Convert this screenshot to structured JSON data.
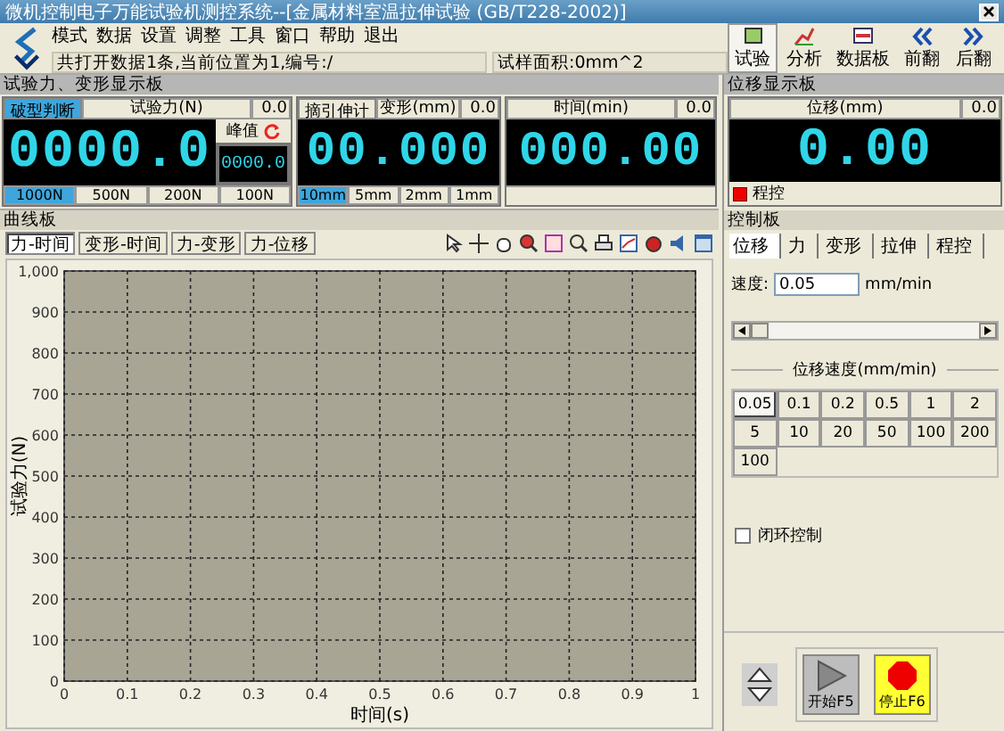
{
  "window": {
    "title": "微机控制电子万能试验机测控系统--[金属材料室温拉伸试验 (GB/T228-2002)]"
  },
  "menu": [
    "模式",
    "数据",
    "设置",
    "调整",
    "工具",
    "窗口",
    "帮助",
    "退出"
  ],
  "status": {
    "message": "共打开数据1条,当前位置为1,编号:/",
    "area": "试样面积:0mm^2"
  },
  "toolbar": [
    {
      "kind": "test",
      "label": "试验",
      "selected": true
    },
    {
      "kind": "analysis",
      "label": "分析",
      "selected": false
    },
    {
      "kind": "data",
      "label": "数据板",
      "selected": false
    },
    {
      "kind": "prev",
      "label": "前翻",
      "selected": false
    },
    {
      "kind": "next",
      "label": "后翻",
      "selected": false
    }
  ],
  "force_panel": {
    "title": "试验力、变形显示板",
    "force": {
      "button": "破型判断",
      "label": "试验力(N)",
      "zero": "0.0",
      "value": "0000.0",
      "peak_label": "峰值",
      "peak_value": "0000.0",
      "ranges": [
        {
          "label": "1000N",
          "selected": true
        },
        {
          "label": "500N",
          "selected": false
        },
        {
          "label": "200N",
          "selected": false
        },
        {
          "label": "100N",
          "selected": false
        }
      ]
    },
    "deform": {
      "button": "摘引伸计",
      "label": "变形(mm)",
      "zero": "0.0",
      "value": "00.000",
      "ranges": [
        {
          "label": "10mm",
          "selected": true
        },
        {
          "label": "5mm",
          "selected": false
        },
        {
          "label": "2mm",
          "selected": false
        },
        {
          "label": "1mm",
          "selected": false
        }
      ]
    },
    "time": {
      "label": "时间(min)",
      "zero": "0.0",
      "value": "000.00"
    }
  },
  "displacement_panel": {
    "title": "位移显示板",
    "label": "位移(mm)",
    "zero": "0.0",
    "value": "0.00",
    "indicator": "程控"
  },
  "curve_panel": {
    "title": "曲线板",
    "tabs": [
      {
        "label": "力-时间",
        "selected": true
      },
      {
        "label": "变形-时间",
        "selected": false
      },
      {
        "label": "力-变形",
        "selected": false
      },
      {
        "label": "力-位移",
        "selected": false
      }
    ],
    "chart_data": {
      "type": "line",
      "grid": true,
      "xlabel": "时间(s)",
      "ylabel": "试验力(N)",
      "xlim": [
        0,
        1
      ],
      "ylim": [
        0,
        1000
      ],
      "xticks": [
        0,
        0.1,
        0.2,
        0.3,
        0.4,
        0.5,
        0.6,
        0.7,
        0.8,
        0.9,
        1
      ],
      "yticks": [
        0,
        100,
        200,
        300,
        400,
        500,
        600,
        700,
        800,
        900,
        {
          "value": 1000,
          "label": "1,000"
        }
      ]
    }
  },
  "control_panel": {
    "title": "控制板",
    "tabs": [
      {
        "label": "位移",
        "selected": true
      },
      {
        "label": "力",
        "selected": false
      },
      {
        "label": "变形",
        "selected": false
      },
      {
        "label": "拉伸",
        "selected": false
      },
      {
        "label": "程控",
        "selected": false
      }
    ],
    "speed_label": "速度:",
    "speed_value": "0.05",
    "speed_unit": "mm/min",
    "slider": {
      "level": 0
    },
    "speed_group": "位移速度(mm/min)",
    "speeds": [
      {
        "label": "0.05",
        "selected": true
      },
      {
        "label": "0.1",
        "selected": false
      },
      {
        "label": "0.2",
        "selected": false
      },
      {
        "label": "0.5",
        "selected": false
      },
      {
        "label": "1",
        "selected": false
      },
      {
        "label": "2",
        "selected": false
      },
      {
        "label": "5",
        "selected": false
      },
      {
        "label": "10",
        "selected": false
      },
      {
        "label": "20",
        "selected": false
      },
      {
        "label": "50",
        "selected": false
      },
      {
        "label": "100",
        "selected": false
      },
      {
        "label": "200",
        "selected": false
      },
      {
        "label": "100",
        "selected": false
      }
    ],
    "closed_loop": {
      "label": "闭环控制",
      "checked": false
    },
    "start": "开始F5",
    "stop": "停止F6"
  }
}
